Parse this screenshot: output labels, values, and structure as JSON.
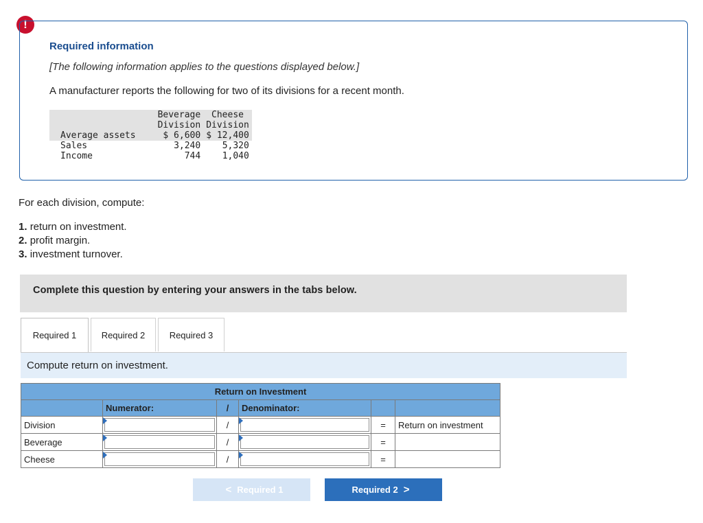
{
  "alert_icon": "!",
  "info": {
    "title": "Required information",
    "note": "[The following information applies to the questions displayed below.]",
    "intro": "A manufacturer reports the following for two of its divisions for a recent month.",
    "table": {
      "col_headers": [
        [
          "Beverage",
          "Division"
        ],
        [
          "Cheese",
          "Division"
        ]
      ],
      "rows": [
        {
          "label": "Average assets",
          "beverage": "$ 6,600",
          "cheese": "$ 12,400"
        },
        {
          "label": "Sales",
          "beverage": "3,240",
          "cheese": "5,320"
        },
        {
          "label": "Income",
          "beverage": "744",
          "cheese": "1,040"
        }
      ]
    }
  },
  "question": {
    "for_each": "For each division, compute:",
    "tasks": [
      {
        "num": "1.",
        "text": "return on investment."
      },
      {
        "num": "2.",
        "text": "profit margin."
      },
      {
        "num": "3.",
        "text": "investment turnover."
      }
    ]
  },
  "banner": "Complete this question by entering your answers in the tabs below.",
  "tabs": [
    "Required 1",
    "Required 2",
    "Required 3"
  ],
  "active_tab": "Required 1",
  "instruction": "Compute return on investment.",
  "roi_table": {
    "title": "Return on Investment",
    "numerator_label": "Numerator:",
    "slash": "/",
    "denominator_label": "Denominator:",
    "equals": "=",
    "col_result": "Return on investment",
    "rows": [
      {
        "label": "Division",
        "numerator": "",
        "denominator": ""
      },
      {
        "label": "Beverage",
        "numerator": "",
        "denominator": ""
      },
      {
        "label": "Cheese",
        "numerator": "",
        "denominator": ""
      }
    ]
  },
  "nav": {
    "prev_label": "Required 1",
    "next_label": "Required 2",
    "prev_icon": "chevron-left-icon",
    "next_icon": "chevron-right-icon",
    "prev_glyph": "<",
    "next_glyph": ">"
  },
  "colors": {
    "alert": "#c8102e",
    "accent_blue": "#2c6fbb",
    "table_header_blue": "#6fa8dc",
    "banner_gray": "#e1e1e1",
    "instruction_bg": "#e3eef9"
  }
}
